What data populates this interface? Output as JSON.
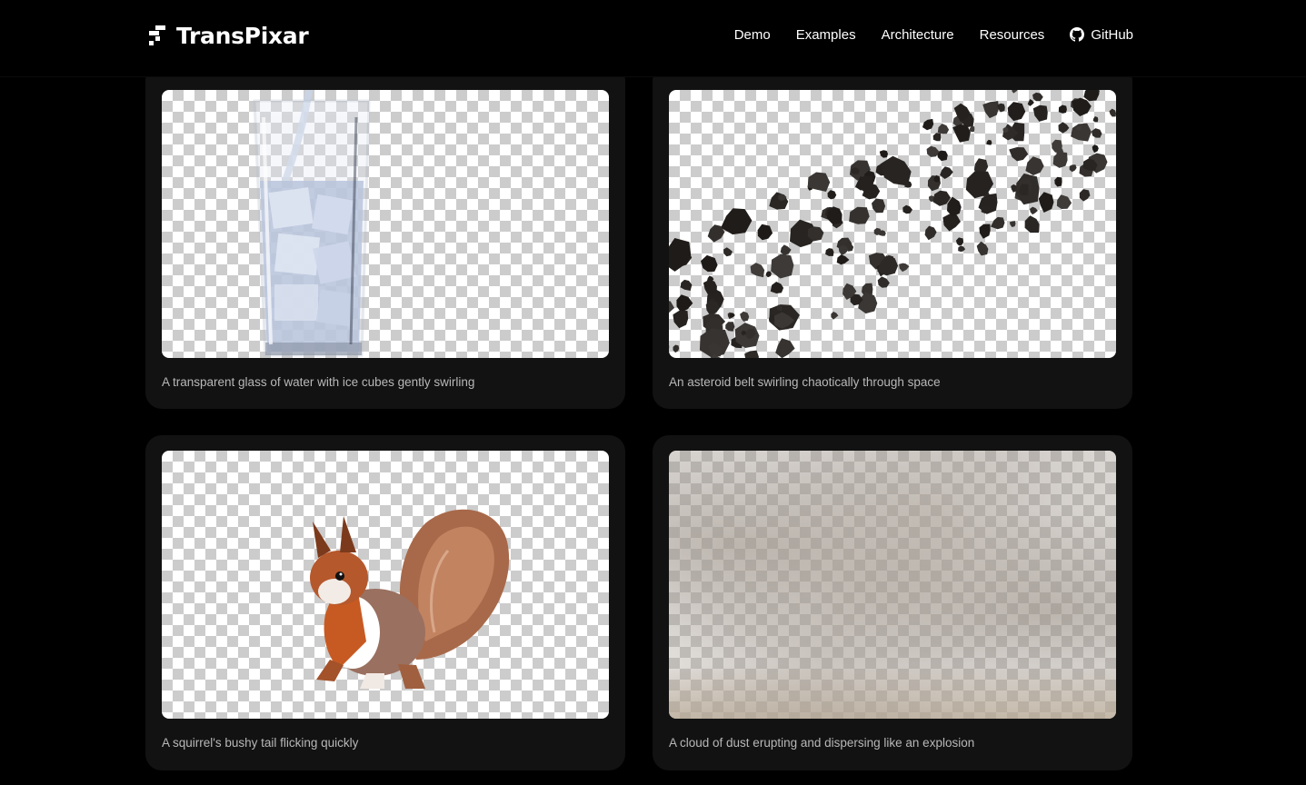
{
  "header": {
    "brand": "TransPixar",
    "nav": [
      {
        "label": "Demo"
      },
      {
        "label": "Examples"
      },
      {
        "label": "Architecture"
      },
      {
        "label": "Resources"
      },
      {
        "label": "GitHub",
        "icon": "github-icon"
      }
    ]
  },
  "examples": [
    {
      "caption": "A transparent glass of water with ice cubes gently swirling",
      "subject": "glass-of-water"
    },
    {
      "caption": "An asteroid belt swirling chaotically through space",
      "subject": "asteroid-belt"
    },
    {
      "caption": "A squirrel's bushy tail flicking quickly",
      "subject": "squirrel"
    },
    {
      "caption": "A cloud of dust erupting and dispersing like an explosion",
      "subject": "dust-cloud"
    }
  ],
  "colors": {
    "background": "#000000",
    "card": "#121212",
    "caption": "#b8b8b8",
    "checker_light": "#ffffff",
    "checker_dark": "#cccccc"
  }
}
